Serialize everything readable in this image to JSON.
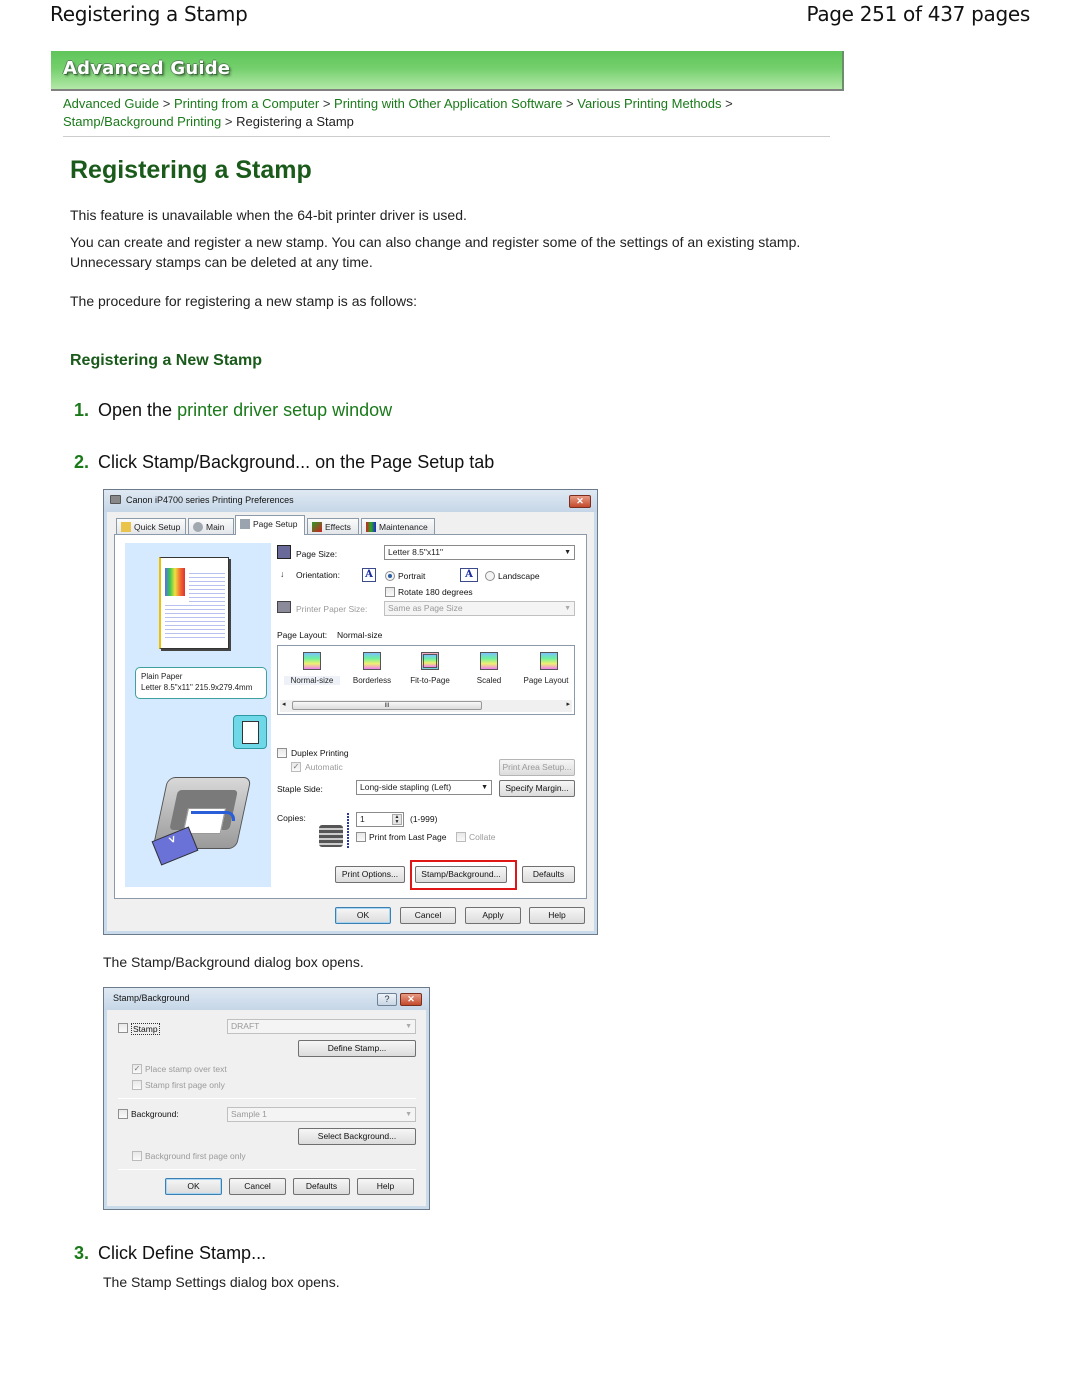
{
  "page_header": {
    "title": "Registering a Stamp",
    "page_indicator": "Page 251 of 437 pages"
  },
  "banner": {
    "label": "Advanced Guide",
    "color": "#6fcb66"
  },
  "breadcrumb": {
    "items": [
      {
        "label": "Advanced Guide",
        "link": true
      },
      {
        "label": "Printing from a Computer",
        "link": true
      },
      {
        "label": "Printing with Other Application Software",
        "link": true
      },
      {
        "label": "Various Printing Methods",
        "link": true
      },
      {
        "label": "Stamp/Background Printing",
        "link": true
      },
      {
        "label": "Registering a Stamp",
        "link": false
      }
    ],
    "separator": ">"
  },
  "article": {
    "title": "Registering a Stamp",
    "paragraphs": [
      "This feature is unavailable when the 64-bit printer driver is used.",
      "You can create and register a new stamp. You can also change and register some of the settings of an existing stamp. Unnecessary stamps can be deleted at any time.",
      "The procedure for registering a new stamp is as follows:"
    ],
    "subheading": "Registering a New Stamp",
    "steps": [
      {
        "num": "1.",
        "text_before": "Open the ",
        "link": "printer driver setup window"
      },
      {
        "num": "2.",
        "text": "Click Stamp/Background... on the Page Setup tab",
        "note": "The Stamp/Background dialog box opens."
      },
      {
        "num": "3.",
        "text": "Click Define Stamp...",
        "note": "The Stamp Settings dialog box opens."
      }
    ],
    "accent_color": "#1a5a1a",
    "link_color": "#1a7a1a"
  },
  "printing_prefs_dialog": {
    "title": "Canon iP4700 series Printing Preferences",
    "close_label": "✕",
    "tabs": [
      {
        "label": "Quick Setup",
        "icon": "quick-setup-icon"
      },
      {
        "label": "Main",
        "icon": "main-icon"
      },
      {
        "label": "Page Setup",
        "icon": "page-setup-icon",
        "active": true
      },
      {
        "label": "Effects",
        "icon": "effects-icon"
      },
      {
        "label": "Maintenance",
        "icon": "maintenance-icon"
      }
    ],
    "preview_info": {
      "line1": "Plain Paper",
      "line2": "Letter 8.5\"x11\" 215.9x279.4mm"
    },
    "page_size_label": "Page Size:",
    "page_size_value": "Letter 8.5\"x11\"",
    "orientation_label": "Orientation:",
    "portrait_label": "Portrait",
    "landscape_label": "Landscape",
    "orientation_selected": "Portrait",
    "rotate_label": "Rotate 180 degrees",
    "rotate_checked": false,
    "printer_paper_size_label": "Printer Paper Size:",
    "printer_paper_size_value": "Same as Page Size",
    "page_layout_label": "Page Layout:",
    "page_layout_value": "Normal-size",
    "layouts": [
      "Normal-size",
      "Borderless",
      "Fit-to-Page",
      "Scaled",
      "Page Layout"
    ],
    "scroll_grip": "III",
    "duplex_label": "Duplex Printing",
    "duplex_checked": false,
    "automatic_label": "Automatic",
    "automatic_checked": true,
    "print_area_setup_label": "Print Area Setup...",
    "staple_side_label": "Staple Side:",
    "staple_side_value": "Long-side stapling (Left)",
    "specify_margin_label": "Specify Margin...",
    "copies_label": "Copies:",
    "copies_value": "1",
    "copies_range": "(1-999)",
    "print_from_last_page_label": "Print from Last Page",
    "collate_label": "Collate",
    "print_options_label": "Print Options...",
    "stamp_background_label": "Stamp/Background...",
    "defaults_label": "Defaults",
    "ok_label": "OK",
    "cancel_label": "Cancel",
    "apply_label": "Apply",
    "help_label": "Help",
    "highlight_color": "#e01515"
  },
  "stamp_background_dialog": {
    "title": "Stamp/Background",
    "help_label": "?",
    "close_label": "✕",
    "stamp_label": "Stamp",
    "stamp_checked": false,
    "stamp_value": "DRAFT",
    "define_stamp_label": "Define Stamp...",
    "place_over_text_label": "Place stamp over text",
    "place_over_text_checked": true,
    "first_page_only_label": "Stamp first page only",
    "first_page_only_checked": false,
    "background_label": "Background:",
    "background_checked": false,
    "background_value": "Sample 1",
    "select_background_label": "Select Background...",
    "background_first_page_label": "Background first page only",
    "background_first_page_checked": false,
    "ok_label": "OK",
    "cancel_label": "Cancel",
    "defaults_label": "Defaults",
    "help_btn_label": "Help"
  }
}
